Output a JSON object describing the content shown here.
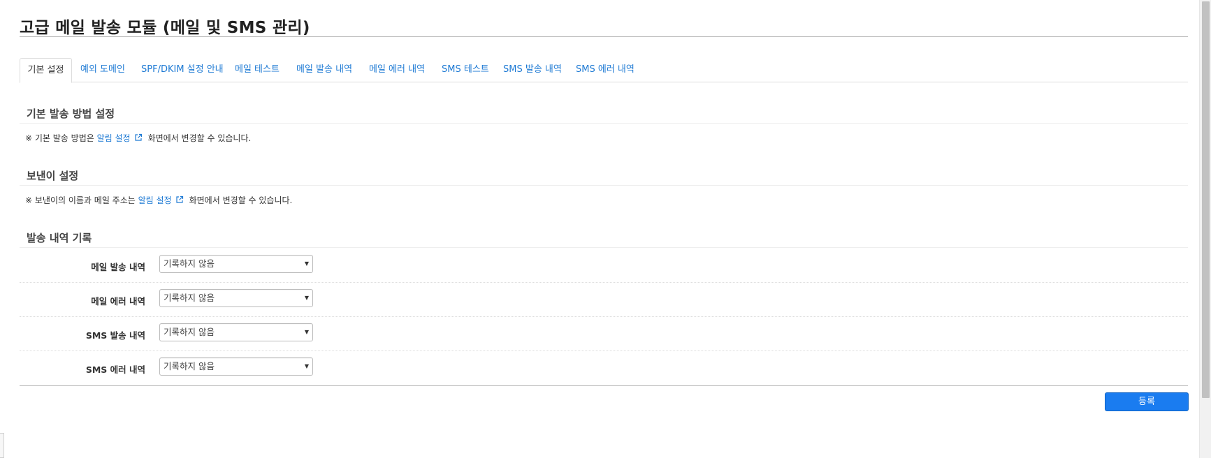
{
  "page": {
    "title": "고급 메일 발송 모듈 (메일 및 SMS 관리)"
  },
  "tabs": [
    {
      "label": "기본 설정",
      "active": true
    },
    {
      "label": "예외 도메인"
    },
    {
      "label": "SPF/DKIM 설정 안내"
    },
    {
      "label": "메일 테스트"
    },
    {
      "label": "메일 발송 내역"
    },
    {
      "label": "메일 에러 내역"
    },
    {
      "label": "SMS 테스트"
    },
    {
      "label": "SMS 발송 내역"
    },
    {
      "label": "SMS 에러 내역"
    }
  ],
  "sections": {
    "send_method": {
      "title": "기본 발송 방법 설정",
      "note_prefix": "※ 기본 발송 방법은 ",
      "link": "알림 설정",
      "note_suffix": "화면에서 변경할 수 있습니다."
    },
    "sender": {
      "title": "보낸이 설정",
      "note_prefix": "※ 보낸이의 이름과 메일 주소는 ",
      "link": "알림 설정",
      "note_suffix": "화면에서 변경할 수 있습니다."
    },
    "log": {
      "title": "발송 내역 기록",
      "rows": [
        {
          "label": "메일 발송 내역",
          "value": "기록하지 않음"
        },
        {
          "label": "메일 에러 내역",
          "value": "기록하지 않음"
        },
        {
          "label": "SMS 발송 내역",
          "value": "기록하지 않음"
        },
        {
          "label": "SMS 에러 내역",
          "value": "기록하지 않음"
        }
      ]
    }
  },
  "submit_label": "등록",
  "colors": {
    "link": "#1e7ad4",
    "primary_button": "#1a7cf0"
  },
  "icons": {
    "external_link": "external-link-icon",
    "select_arrow": "▼"
  }
}
